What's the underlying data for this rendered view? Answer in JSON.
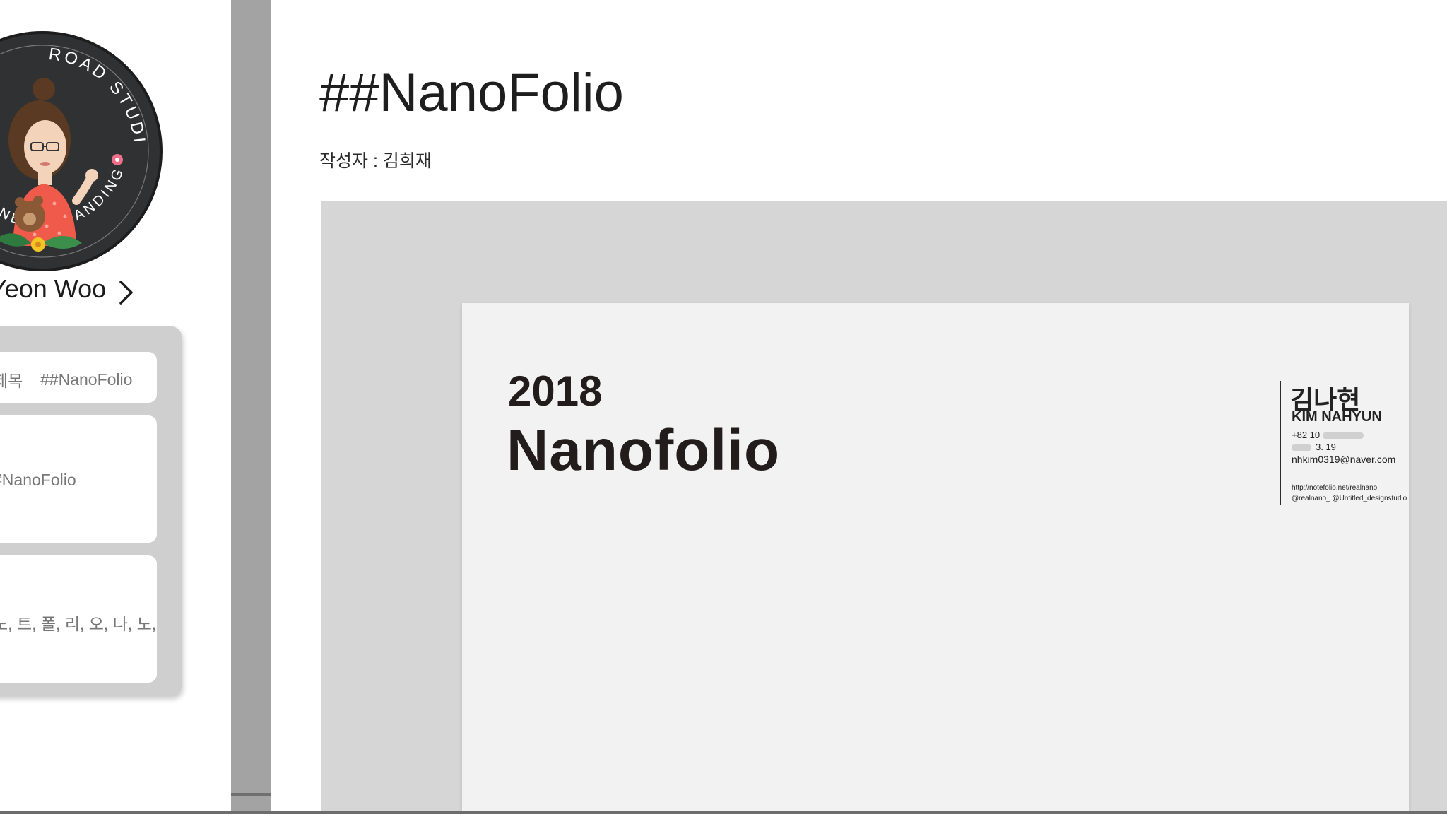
{
  "profile": {
    "logo_ring_top": "ROAD STUDIOS",
    "logo_ring_bottom": "BUSINESS BRANDING",
    "name": "Yeon Woo"
  },
  "info_card": {
    "title_label": "제목",
    "title_value": "##NanoFolio",
    "hashtag_value": "#NanoFolio",
    "keywords_value": "노, 트, 폴, 리, 오, 나, 노,"
  },
  "document": {
    "title": "##NanoFolio",
    "author": "작성자 : 김희재"
  },
  "cover": {
    "year": "2018",
    "name": "Nanofolio",
    "name_kr": "김나현",
    "name_en": "KIM NAHYUN",
    "phone_prefix": "+82 10",
    "birth_suffix": "3. 19",
    "email": "nhkim0319@naver.com",
    "url": "http://notefolio.net/realnano",
    "social": "@realnano_   @Untitled_designstudio"
  },
  "colors": {
    "background": "#a3a3a3",
    "badge": "#2f3133",
    "card": "#cfcfcf",
    "preview": "#d6d6d6",
    "sheet": "#f2f2f2"
  }
}
